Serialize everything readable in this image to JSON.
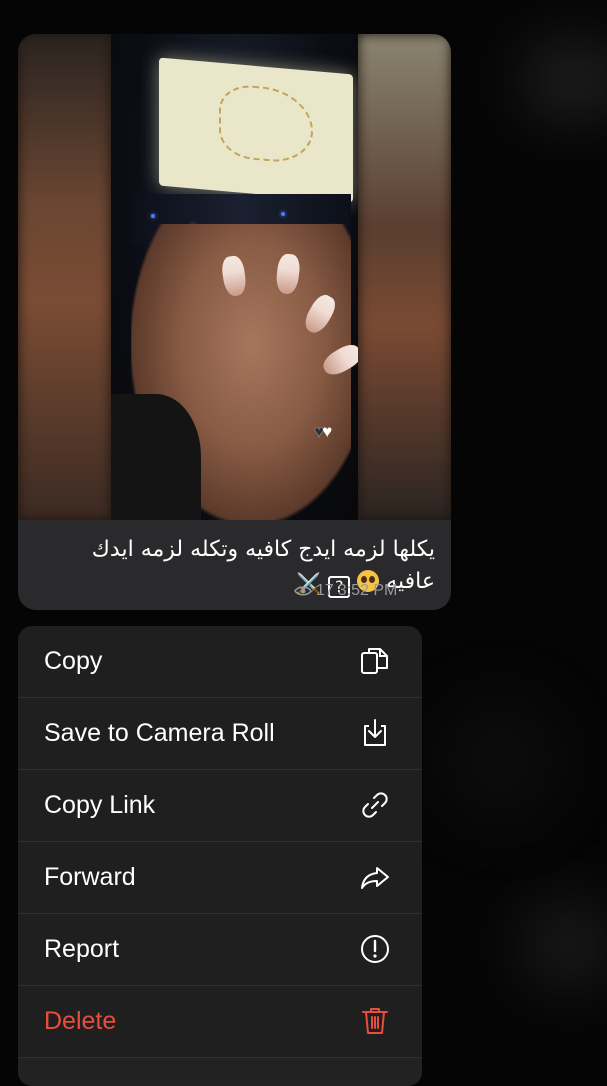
{
  "message": {
    "caption_line1": "يكلها لزمه ايدج كافيه وتكله لزمه ايدك",
    "caption_line2": "عافيه",
    "caption_emojis": [
      "pleading-face-emoji",
      "question-mark-box-emoji",
      "crossed-swords-emoji"
    ],
    "swords_glyph": "⚔️",
    "question_glyph": "?",
    "views": "17",
    "time": "3:52 PM",
    "media_overlay_hearts": [
      "black-heart",
      "white-heart"
    ],
    "hearts_glyph_dark": "♥",
    "hearts_glyph_light": "♥"
  },
  "context_menu": {
    "items": [
      {
        "label": "Copy",
        "icon": "copy-icon"
      },
      {
        "label": "Save to Camera Roll",
        "icon": "save-download-icon"
      },
      {
        "label": "Copy Link",
        "icon": "link-icon"
      },
      {
        "label": "Forward",
        "icon": "forward-arrow-icon"
      },
      {
        "label": "Report",
        "icon": "report-exclamation-icon"
      },
      {
        "label": "Delete",
        "icon": "trash-icon",
        "destructive": true
      }
    ]
  },
  "colors": {
    "background": "#050505",
    "bubble": "#2a2a2c",
    "menu": "#1f1f1f",
    "destructive": "#eb4d3d",
    "meta_text": "#9a9a9e"
  }
}
